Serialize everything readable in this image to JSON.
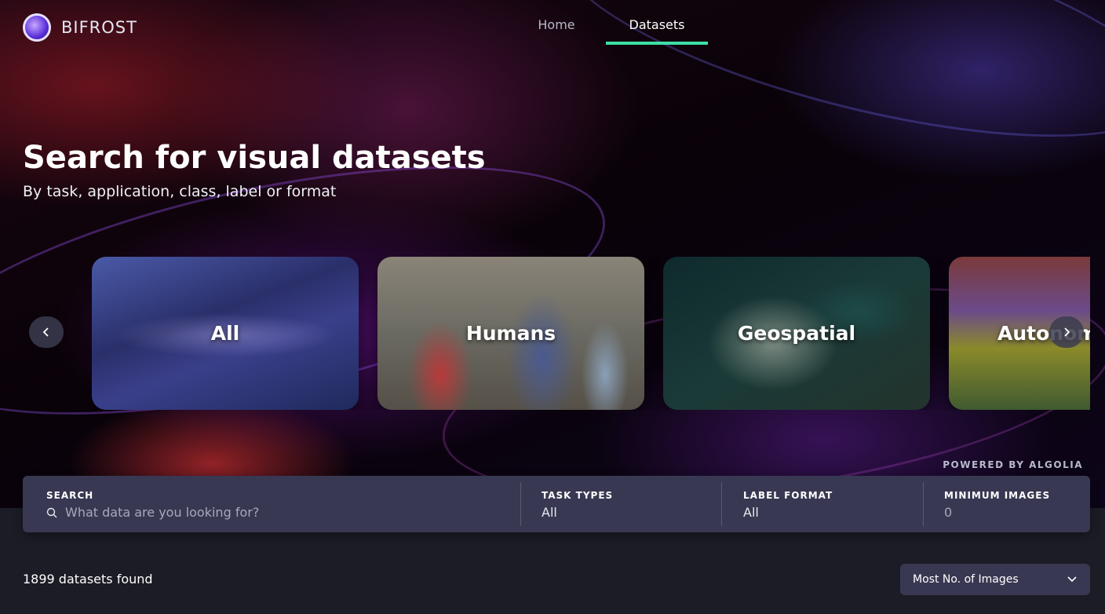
{
  "app": {
    "logo_text": "BIFROST"
  },
  "nav": {
    "home": "Home",
    "datasets": "Datasets"
  },
  "hero": {
    "title": "Search for visual datasets",
    "subtitle": "By task, application, class, label or format"
  },
  "carousel": {
    "cards": [
      {
        "label": "All"
      },
      {
        "label": "Humans"
      },
      {
        "label": "Geospatial"
      },
      {
        "label": "Autonomous"
      }
    ],
    "prev_icon": "chevron-left-icon",
    "next_icon": "chevron-right-icon"
  },
  "search": {
    "powered_by": "POWERED BY ALGOLIA",
    "search_label": "SEARCH",
    "search_placeholder": "What data are you looking for?",
    "task_types_label": "TASK TYPES",
    "task_types_value": "All",
    "label_format_label": "LABEL FORMAT",
    "label_format_value": "All",
    "min_images_label": "MINIMUM IMAGES",
    "min_images_value": "0"
  },
  "results": {
    "count_text": "1899 datasets found",
    "sort_selected": "Most No. of Images"
  },
  "colors": {
    "accent": "#3ee0a8",
    "panel": "#383852",
    "background": "#1c1c26"
  }
}
